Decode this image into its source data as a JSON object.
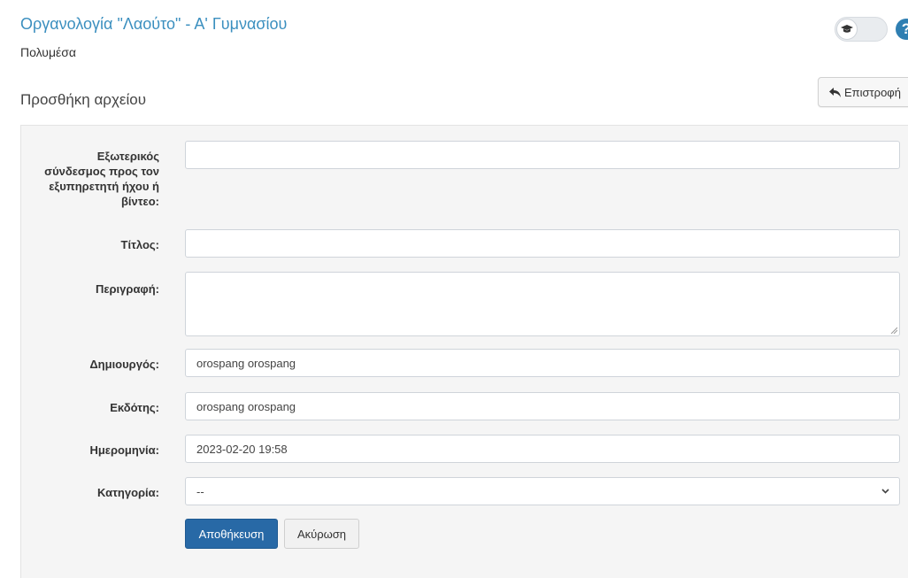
{
  "header": {
    "course_title": "Οργανολογία \"Λαούτο\" - Α' Γυμνασίου",
    "module_name": "Πολυμέσα",
    "help_symbol": "?"
  },
  "page": {
    "section_title": "Προσθήκη αρχείου",
    "back_label": "Επιστροφή"
  },
  "form": {
    "url_label": "Εξωτερικός σύνδεσμος προς τον εξυπηρετητή ήχου ή βίντεο:",
    "url_value": "",
    "title_label": "Τίτλος:",
    "title_value": "",
    "description_label": "Περιγραφή:",
    "description_value": "",
    "creator_label": "Δημιουργός:",
    "creator_value": "orospang orospang",
    "publisher_label": "Εκδότης:",
    "publisher_value": "orospang orospang",
    "date_label": "Ημερομηνία:",
    "date_value": "2023-02-20 19:58",
    "category_label": "Κατηγορία:",
    "category_value": "--",
    "save_label": "Αποθήκευση",
    "cancel_label": "Ακύρωση"
  },
  "colors": {
    "accent": "#3b8fbf",
    "primary_button": "#2869a6",
    "panel_bg": "#f5f5f5"
  },
  "icons": {
    "toggle": "graduation-cap-icon",
    "help": "question-circle-icon",
    "back": "reply-arrow-icon",
    "select": "chevron-down-icon"
  }
}
